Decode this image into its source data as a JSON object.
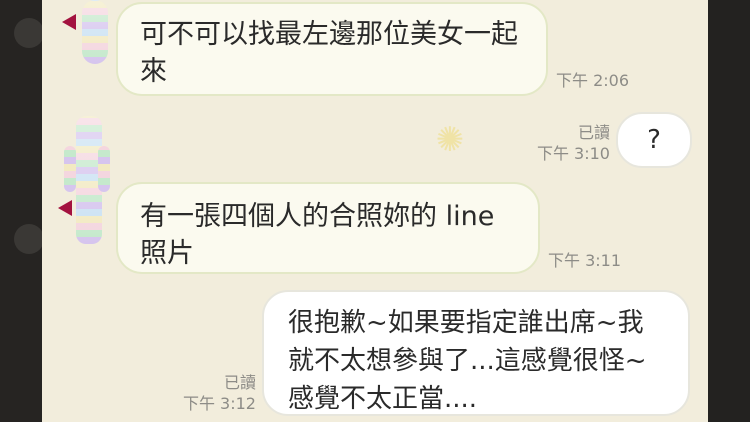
{
  "messages": [
    {
      "side": "incoming",
      "text": "可不可以找最左邊那位美女一起來",
      "time": "下午 2:06"
    },
    {
      "side": "outgoing",
      "text": "?",
      "read": "已讀",
      "time": "下午 3:10"
    },
    {
      "side": "incoming",
      "text": "有一張四個人的合照妳的 line 照片",
      "time": "下午 3:11"
    },
    {
      "side": "outgoing",
      "text": "很抱歉~如果要指定誰出席~我就不太想參與了...這感覺很怪~感覺不太正當....",
      "read": "已讀",
      "time": "下午 3:12"
    }
  ],
  "colors": {
    "chat_background": "#f2eddc",
    "incoming_bubble": "#fbfaef",
    "outgoing_bubble": "#ffffff",
    "meta_text": "#8d8c87"
  },
  "icons": {
    "sticker": "sparkle-sticker-icon"
  }
}
